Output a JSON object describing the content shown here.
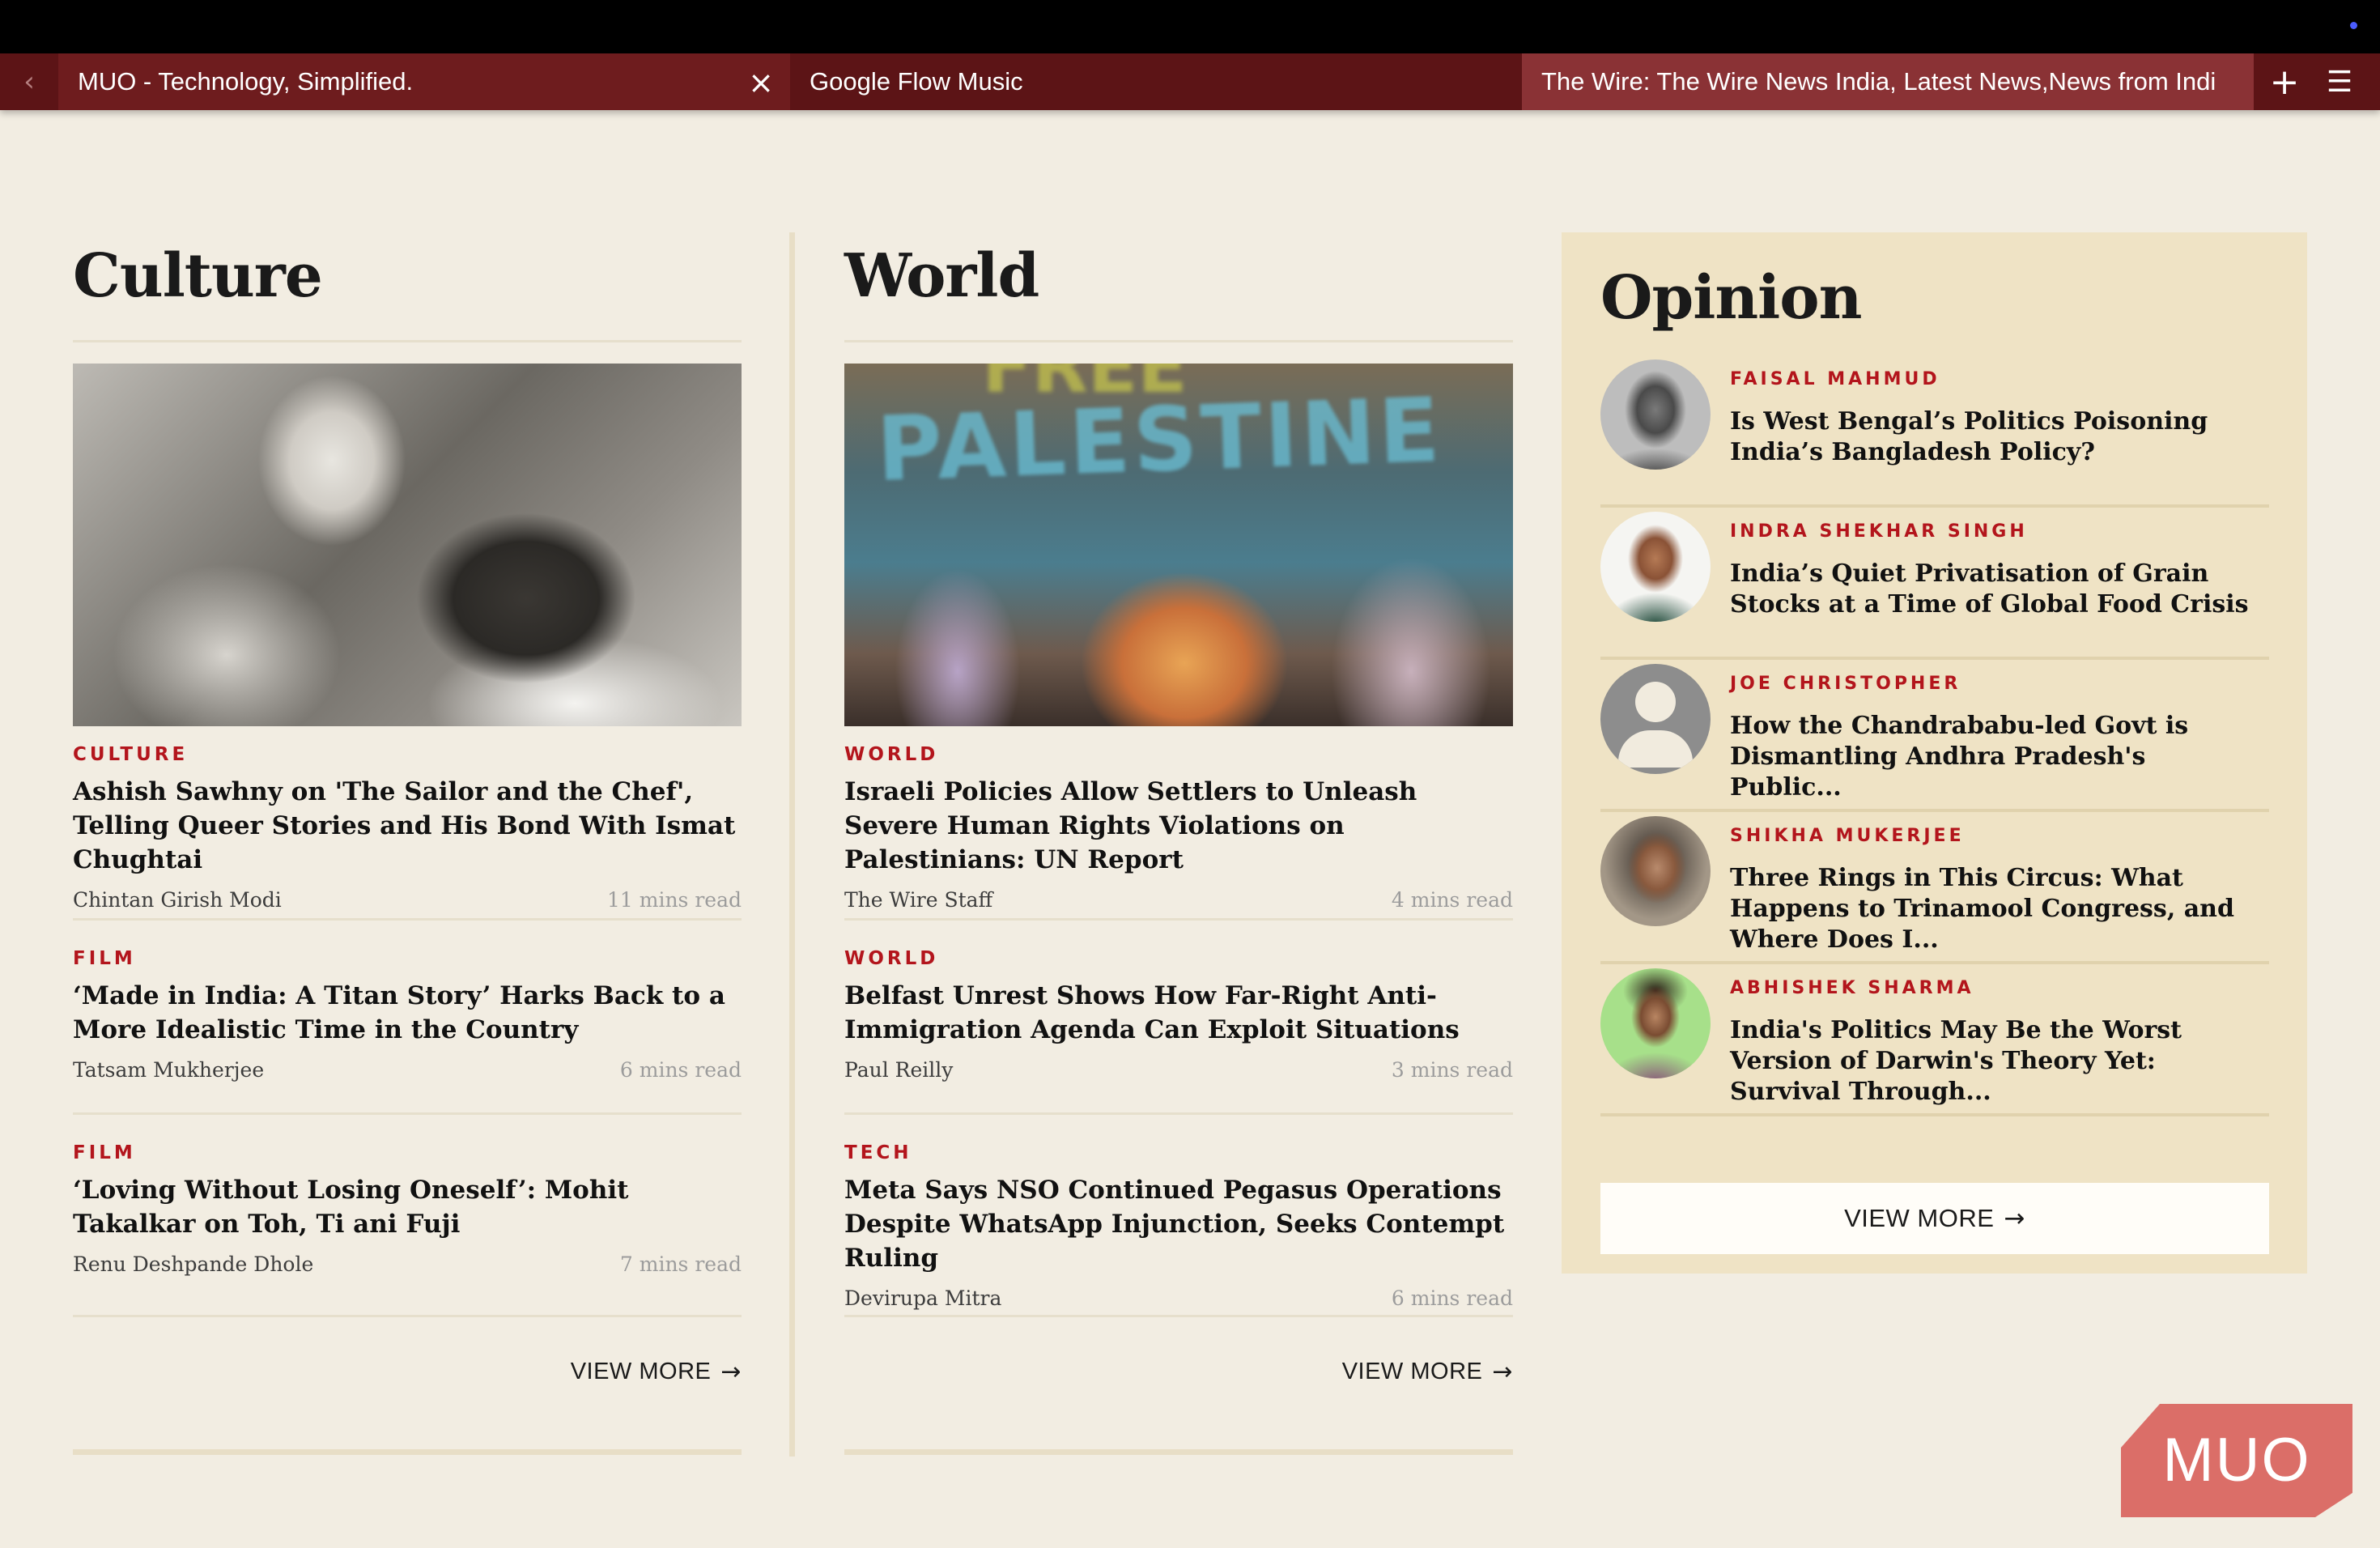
{
  "browser": {
    "tabs": [
      {
        "label": "MUO - Technology, Simplified."
      },
      {
        "label": "Google Flow Music"
      },
      {
        "label": "The Wire: The Wire News India, Latest News,News from Indi"
      }
    ]
  },
  "culture": {
    "title": "Culture",
    "stories": [
      {
        "category": "CULTURE",
        "headline": "Ashish Sawhny on 'The Sailor and the Chef', Telling Queer Stories and His Bond With Ismat Chughtai",
        "author": "Chintan Girish Modi",
        "read_time": "11 mins read"
      },
      {
        "category": "FILM",
        "headline": "‘Made in India: A Titan Story’ Harks Back to a More Idealistic Time in the Country",
        "author": "Tatsam Mukherjee",
        "read_time": "6 mins read"
      },
      {
        "category": "FILM",
        "headline": "‘Loving Without Losing Oneself’: Mohit Takalkar on Toh, Ti ani Fuji",
        "author": "Renu Deshpande Dhole",
        "read_time": "7 mins read"
      }
    ],
    "view_more": "VIEW MORE"
  },
  "world": {
    "title": "World",
    "image_text": [
      "FREE",
      "PALESTINE"
    ],
    "stories": [
      {
        "category": "WORLD",
        "headline": "Israeli Policies Allow Settlers to Unleash Severe Human Rights Violations on Palestinians: UN Report",
        "author": "The Wire Staff",
        "read_time": "4 mins read"
      },
      {
        "category": "WORLD",
        "headline": "Belfast Unrest Shows How Far-Right Anti-Immigration Agenda Can Exploit Situations",
        "author": "Paul Reilly",
        "read_time": "3 mins read"
      },
      {
        "category": "TECH",
        "headline": "Meta Says NSO Continued Pegasus Operations Despite WhatsApp Injunction, Seeks Contempt Ruling",
        "author": "Devirupa Mitra",
        "read_time": "6 mins read"
      }
    ],
    "view_more": "VIEW MORE"
  },
  "opinion": {
    "title": "Opinion",
    "items": [
      {
        "author": "FAISAL MAHMUD",
        "headline": "Is West Bengal’s Politics Poisoning India’s Bangladesh Policy?"
      },
      {
        "author": "INDRA SHEKHAR SINGH",
        "headline": "India’s Quiet Privatisation of Grain Stocks at a Time of Global Food Crisis"
      },
      {
        "author": "JOE CHRISTOPHER",
        "headline": "How the Chandrababu-led Govt is Dismantling Andhra Pradesh's Public..."
      },
      {
        "author": "SHIKHA MUKERJEE",
        "headline": "Three Rings in This Circus: What Happens to Trinamool Congress, and Where Does I..."
      },
      {
        "author": "ABHISHEK SHARMA",
        "headline": "India's Politics May Be the Worst Version of Darwin's Theory Yet: Survival Through..."
      }
    ],
    "view_more": "VIEW MORE"
  },
  "watermark": {
    "label": "MUO"
  },
  "icons": {
    "back": "chevron-left-icon",
    "close": "close-icon",
    "new_tab": "plus-icon",
    "menu": "hamburger-menu-icon",
    "arrow": "arrow-right-icon"
  },
  "colors": {
    "page_bg": "#f2ede2",
    "tab_bar": "#5c1416",
    "accent_red": "#b3151c",
    "opinion_bg": "#efe3c5",
    "watermark": "#d9635d"
  }
}
